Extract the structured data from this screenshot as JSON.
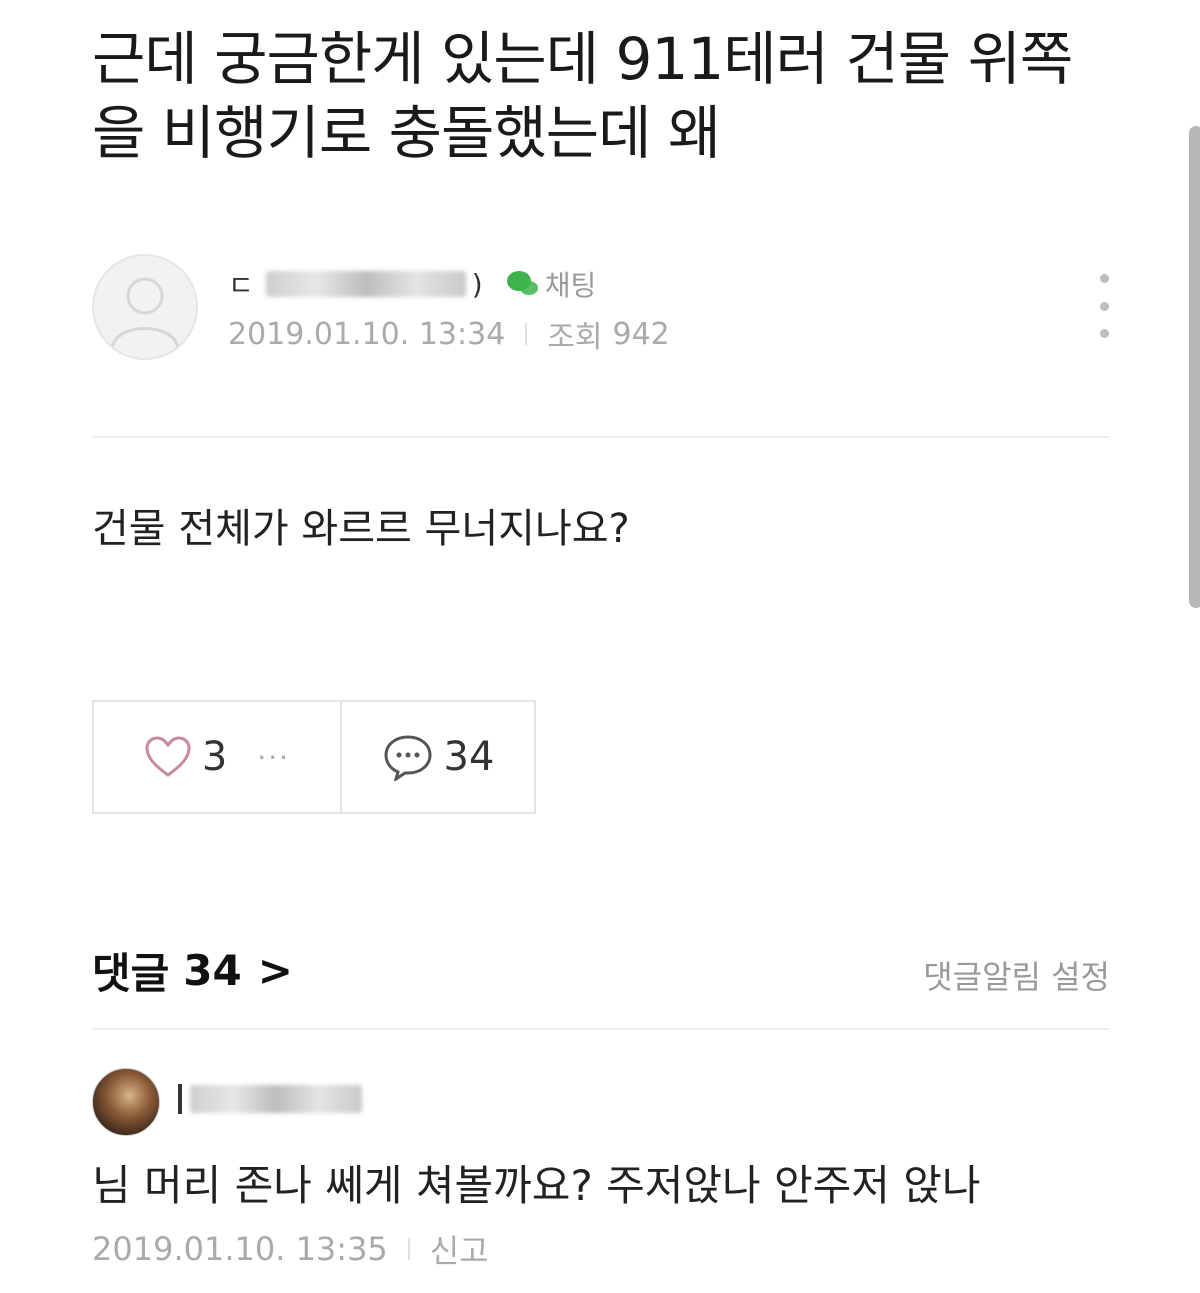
{
  "post": {
    "title": "근데 궁금한게 있는데 911테러 건물 위쪽을 비행기로 충돌했는데 왜",
    "author_initial": "ㄷ",
    "author_suffix": ")",
    "chat_label": "채팅",
    "date": "2019.01.10. 13:34",
    "views_label": "조회",
    "views": "942",
    "body": "건물 전체가 와르르 무너지나요?",
    "likes": "3",
    "more": "···",
    "comment_count": "34",
    "menu_icon": "more-vertical-icon"
  },
  "comments_section": {
    "header": "댓글",
    "count": "34",
    "chevron": ">",
    "alert_label": "댓글알림 설정"
  },
  "comments": [
    {
      "text": "님 머리 존나 쎄게 쳐볼까요? 주저앉나 안주저 앉나",
      "date": "2019.01.10. 13:35",
      "report": "신고"
    }
  ],
  "colors": {
    "chat_green": "#3cb44b",
    "heart": "#c98a9b",
    "muted": "#aaaaaa"
  }
}
